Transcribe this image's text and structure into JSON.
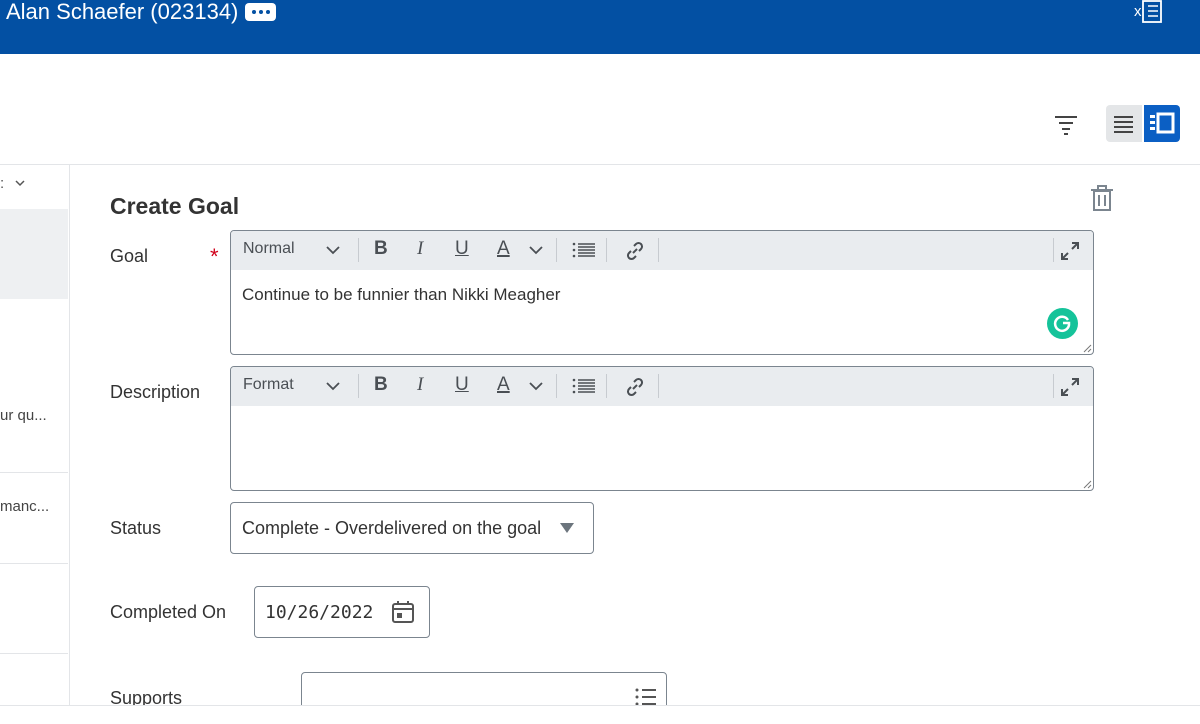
{
  "header": {
    "title": "Alan Schaefer (023134)",
    "more_icon": "more-dots-icon",
    "export_icon": "excel-export-icon"
  },
  "toolbar": {
    "filter_icon": "filter-icon",
    "view_list_icon": "list-view-icon",
    "view_card_icon": "card-view-icon"
  },
  "left_panel": {
    "sort_label": ":",
    "items": [
      "ur qu...",
      "manc..."
    ]
  },
  "form": {
    "title": "Create Goal",
    "goal": {
      "label": "Goal",
      "required": "*",
      "format": "Normal",
      "value": "Continue to be funnier than Nikki Meagher"
    },
    "description": {
      "label": "Description",
      "format": "Format",
      "value": ""
    },
    "status": {
      "label": "Status",
      "value": "Complete - Overdelivered on the goal"
    },
    "completed_on": {
      "label": "Completed On",
      "value": "10/26/2022"
    },
    "supports": {
      "label": "Supports"
    }
  },
  "editor_buttons": {
    "bold": "B",
    "italic": "I",
    "underline": "U",
    "color": "A"
  },
  "colors": {
    "header_bg": "#0350a3",
    "accent": "#0b5fc4",
    "required": "#d0021b",
    "grammarly": "#15c39a"
  }
}
